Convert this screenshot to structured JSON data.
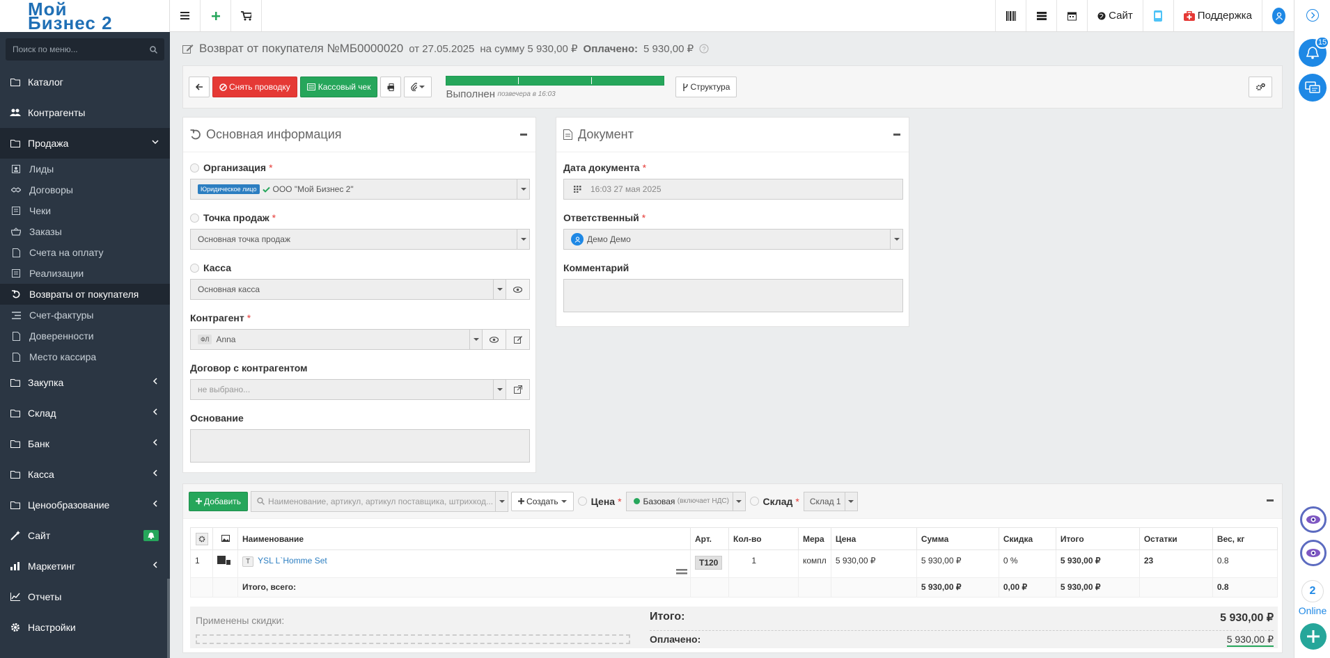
{
  "header": {
    "logo_line1": "Мой",
    "logo_line2": "Бизнес 2",
    "site_label": "Сайт",
    "support_label": "Поддержка"
  },
  "sidebar": {
    "search_placeholder": "Поиск по меню...",
    "items": [
      {
        "label": "Каталог",
        "icon": "folder-icon"
      },
      {
        "label": "Контрагенты",
        "icon": "users-icon"
      },
      {
        "label": "Продажа",
        "icon": "folder-icon"
      },
      {
        "label": "Закупка",
        "icon": "folder-icon"
      },
      {
        "label": "Склад",
        "icon": "folder-icon"
      },
      {
        "label": "Банк",
        "icon": "folder-icon"
      },
      {
        "label": "Касса",
        "icon": "folder-icon"
      },
      {
        "label": "Ценообразование",
        "icon": "folder-icon"
      },
      {
        "label": "Сайт",
        "icon": "wand-icon"
      },
      {
        "label": "Маркетинг",
        "icon": "chart-icon"
      },
      {
        "label": "Отчеты",
        "icon": "line-chart-icon"
      },
      {
        "label": "Настройки",
        "icon": "gear-icon"
      }
    ],
    "sub_items": [
      "Лиды",
      "Договоры",
      "Чеки",
      "Заказы",
      "Счета на оплату",
      "Реализации",
      "Возвраты от покупателя",
      "Счет-фактуры",
      "Доверенности",
      "Место кассира"
    ]
  },
  "title": {
    "text": "Возврат от покупателя №МБ0000020",
    "date_part": "от 27.05.2025",
    "sum_part": "на сумму 5 930,00 ₽",
    "paid_label": "Оплачено:",
    "paid_value": "5 930,00 ₽"
  },
  "toolbar": {
    "unpost_label": "Снять проводку",
    "receipt_label": "Кассовый чек",
    "status_label": "Выполнен",
    "status_time": "позвечера в 16:03",
    "progress": 1.0,
    "structure_label": "Структура"
  },
  "main_info": {
    "title": "Основная информация",
    "org_label": "Организация",
    "org_tag": "Юридическое лицо",
    "org_value": "ООО \"Мой Бизнес 2\"",
    "pos_label": "Точка продаж",
    "pos_value": "Основная точка продаж",
    "cash_label": "Касса",
    "cash_value": "Основная касса",
    "contractor_label": "Контрагент",
    "contractor_tag": "ФЛ",
    "contractor_value": "Anna",
    "contract_label": "Договор с контрагентом",
    "contract_placeholder": "не выбрано...",
    "basis_label": "Основание"
  },
  "document": {
    "title": "Документ",
    "date_label": "Дата документа",
    "date_value": "16:03 27 мая 2025",
    "resp_label": "Ответственный",
    "resp_value": "Демо Демо",
    "comment_label": "Комментарий"
  },
  "items": {
    "add_label": "Добавить",
    "search_placeholder": "Наименование, артикул, артикул поставщика, штрихкод...",
    "create_label": "Создать",
    "price_label": "Цена",
    "price_value": "Базовая",
    "price_note": "(включает НДС)",
    "warehouse_label": "Склад",
    "warehouse_value": "Склад 1",
    "columns": [
      "Наименование",
      "Арт.",
      "Кол-во",
      "Мера",
      "Цена",
      "Сумма",
      "Скидка",
      "Итого",
      "Остатки",
      "Вес, кг"
    ],
    "rows": [
      {
        "num": "1",
        "type": "Т",
        "name": "YSL L`Homme Set",
        "art": "T120",
        "qty": "1",
        "unit": "компл",
        "price": "5 930,00 ₽",
        "sum": "5 930,00 ₽",
        "discount": "0 %",
        "total": "5 930,00 ₽",
        "stock": "23",
        "weight": "0.8"
      }
    ],
    "total_row": {
      "label": "Итого, всего:",
      "sum": "5 930,00 ₽",
      "discount": "0,00 ₽",
      "total": "5 930,00 ₽",
      "weight": "0.8"
    },
    "discounts_label": "Применены скидки:",
    "grand_total_label": "Итого:",
    "grand_total_value": "5 930,00 ₽",
    "paid_label": "Оплачено:",
    "paid_value": "5 930,00 ₽"
  },
  "rail": {
    "notif_count": "15",
    "online_count": "2",
    "online_label": "Online"
  },
  "colors": {
    "sidebar": "#2b3643",
    "accent": "#1e88e5",
    "green": "#26a65b",
    "red": "#e53935"
  }
}
